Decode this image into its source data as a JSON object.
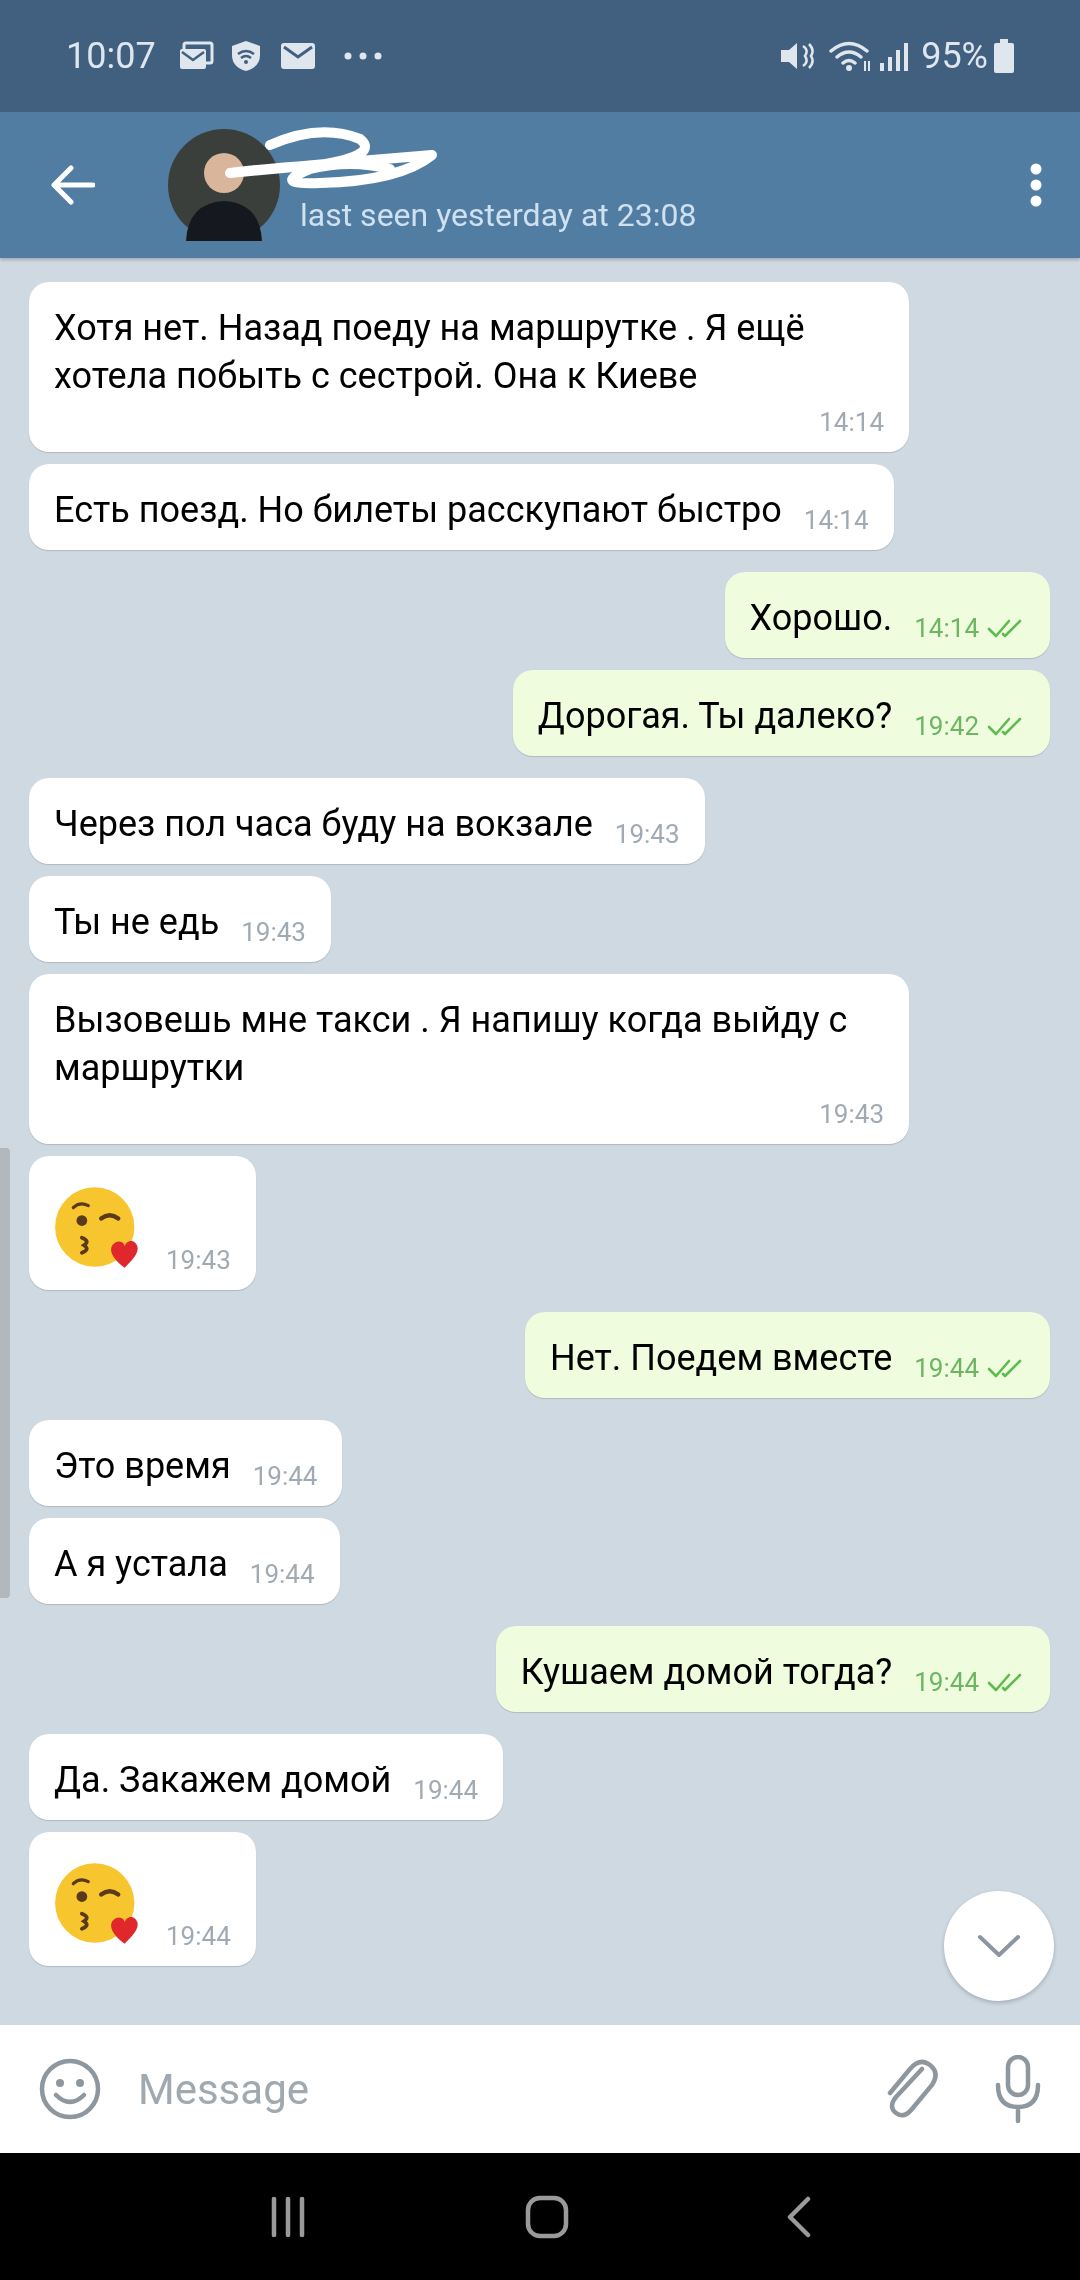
{
  "status_bar": {
    "time": "10:07",
    "battery": "95%"
  },
  "header": {
    "last_seen": "last seen yesterday at 23:08"
  },
  "messages": [
    {
      "outgoing": false,
      "kind": "text",
      "text": "Хотя нет. Назад поеду на маршрутке . Я ещё хотела побыть с сестрой. Она к Киеве",
      "time": "14:14"
    },
    {
      "outgoing": false,
      "kind": "text",
      "text": "Есть поезд. Но билеты расскупают быстро",
      "time": "14:14"
    },
    {
      "outgoing": true,
      "kind": "text",
      "text": "Хорошо.",
      "time": "14:14",
      "read": true
    },
    {
      "outgoing": true,
      "kind": "text",
      "text": "Дорогая. Ты далеко?",
      "time": "19:42",
      "read": true
    },
    {
      "outgoing": false,
      "kind": "text",
      "text": "Через пол часа буду на вокзале",
      "time": "19:43"
    },
    {
      "outgoing": false,
      "kind": "text",
      "text": "Ты не едь",
      "time": "19:43"
    },
    {
      "outgoing": false,
      "kind": "text",
      "text": "Вызовешь мне такси . Я напишу когда выйду с маршрутки",
      "time": "19:43"
    },
    {
      "outgoing": false,
      "kind": "emoji",
      "time": "19:43"
    },
    {
      "outgoing": true,
      "kind": "text",
      "text": "Нет. Поедем вместе",
      "time": "19:44",
      "read": true
    },
    {
      "outgoing": false,
      "kind": "text",
      "text": "Это время",
      "time": "19:44"
    },
    {
      "outgoing": false,
      "kind": "text",
      "text": "А я устала",
      "time": "19:44"
    },
    {
      "outgoing": true,
      "kind": "text",
      "text": "Кушаем домой тогда?",
      "time": "19:44",
      "read": true
    },
    {
      "outgoing": false,
      "kind": "text",
      "text": "Да. Закажем домой",
      "time": "19:44"
    },
    {
      "outgoing": false,
      "kind": "emoji",
      "time": "19:44"
    }
  ],
  "composer": {
    "placeholder": "Message"
  }
}
